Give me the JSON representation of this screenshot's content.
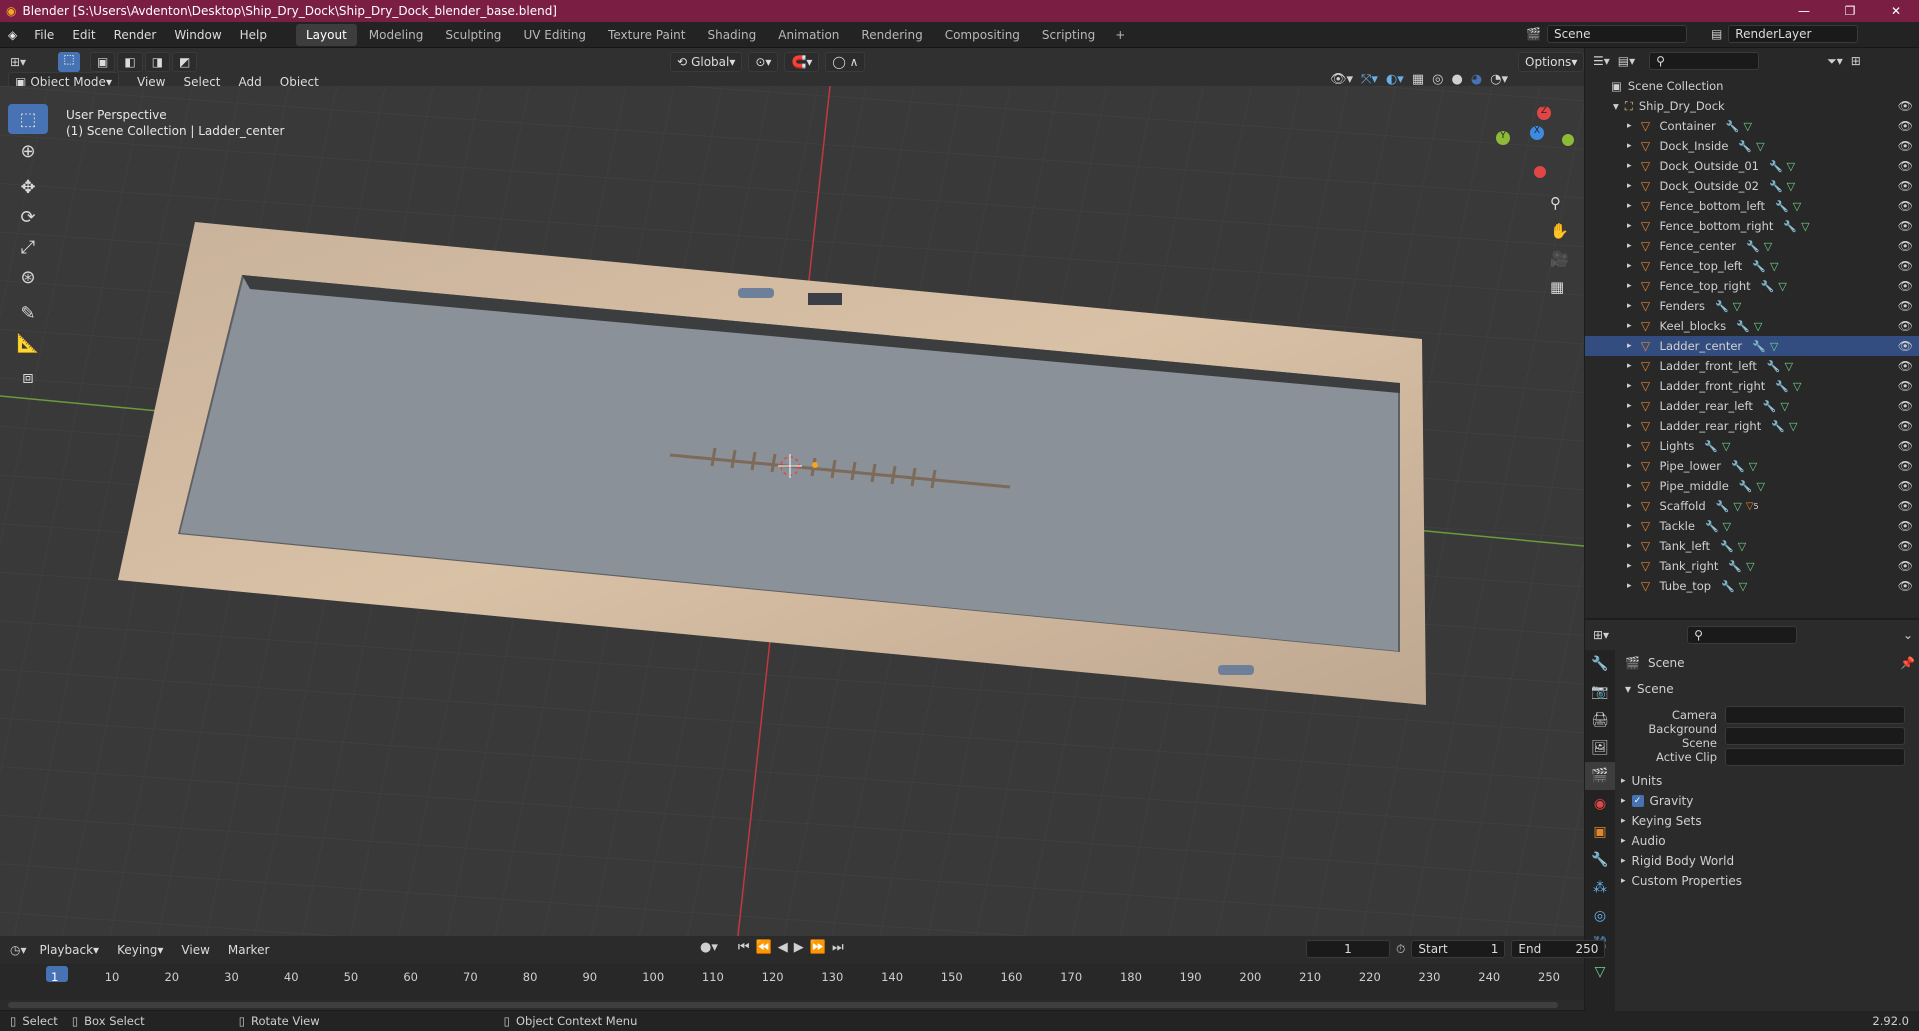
{
  "window": {
    "title": "Blender [S:\\Users\\Avdenton\\Desktop\\Ship_Dry_Dock\\Ship_Dry_Dock_blender_base.blend]",
    "min": "—",
    "max": "❐",
    "close": "✕"
  },
  "menu": [
    "File",
    "Edit",
    "Render",
    "Window",
    "Help"
  ],
  "workspaces": [
    "Layout",
    "Modeling",
    "Sculpting",
    "UV Editing",
    "Texture Paint",
    "Shading",
    "Animation",
    "Rendering",
    "Compositing",
    "Scripting"
  ],
  "active_workspace": "Layout",
  "add_tab": "+",
  "scene": {
    "name": "Scene",
    "view_layer": "RenderLayer"
  },
  "viewport_header": {
    "mode": "Object Mode",
    "menus": [
      "View",
      "Select",
      "Add",
      "Object"
    ],
    "transform": "Global",
    "options": "Options"
  },
  "viewport": {
    "perspective": "User Perspective",
    "collection_info": "(1) Scene Collection | Ladder_center"
  },
  "gizmo": {
    "x": "X",
    "y": "Y",
    "z": "Z"
  },
  "outliner": {
    "root": "Scene Collection",
    "collection": "Ship_Dry_Dock",
    "objects": [
      "Container",
      "Dock_Inside",
      "Dock_Outside_01",
      "Dock_Outside_02",
      "Fence_bottom_left",
      "Fence_bottom_right",
      "Fence_center",
      "Fence_top_left",
      "Fence_top_right",
      "Fenders",
      "Keel_blocks",
      "Ladder_center",
      "Ladder_front_left",
      "Ladder_front_right",
      "Ladder_rear_left",
      "Ladder_rear_right",
      "Lights",
      "Pipe_lower",
      "Pipe_middle",
      "Scaffold",
      "Tackle",
      "Tank_left",
      "Tank_right",
      "Tube_top"
    ],
    "selected": "Ladder_center",
    "scaffold_badge": "5"
  },
  "properties": {
    "context": "Scene",
    "panel": "Scene",
    "fields": [
      {
        "label": "Camera",
        "value": ""
      },
      {
        "label": "Background Scene",
        "value": ""
      },
      {
        "label": "Active Clip",
        "value": ""
      }
    ],
    "subpanels": [
      "Units",
      "Gravity",
      "Keying Sets",
      "Audio",
      "Rigid Body World",
      "Custom Properties"
    ],
    "gravity_checked": true
  },
  "timeline": {
    "menus": [
      "Playback",
      "Keying",
      "View",
      "Marker"
    ],
    "current_frame": "1",
    "start_label": "Start",
    "start": "1",
    "end_label": "End",
    "end": "250",
    "ticks": [
      "1",
      "10",
      "20",
      "30",
      "40",
      "50",
      "60",
      "70",
      "80",
      "90",
      "100",
      "110",
      "120",
      "130",
      "140",
      "150",
      "160",
      "170",
      "180",
      "190",
      "200",
      "210",
      "220",
      "230",
      "240",
      "250"
    ]
  },
  "statusbar": {
    "select": "Select",
    "box_select": "Box Select",
    "rotate": "Rotate View",
    "context_menu": "Object Context Menu",
    "version": "2.92.0"
  }
}
